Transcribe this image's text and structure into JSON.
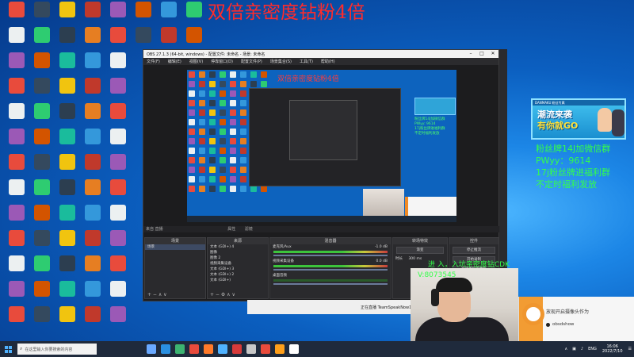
{
  "banner": {
    "text": "双倍亲密度钻粉4倍"
  },
  "obs": {
    "title": "OBS 27.1.3 (64-bit, windows) - 配置文件: 未命名 - 场景: 未命名",
    "menu": [
      "文件(F)",
      "编辑(E)",
      "视图(V)",
      "停靠窗口(D)",
      "配置文件(P)",
      "场景集合(S)",
      "工具(T)",
      "帮助(H)"
    ],
    "preview_banner": "双倍亲密度钻粉4倍",
    "preview_green_lines": [
      "粉丝牌14J加微信群",
      "PWyy: 9614",
      "17j粉丝牌进福利群",
      "不定时福利发放"
    ],
    "status_left": "来自 直播",
    "status_mid_1": "属性",
    "status_mid_2": "滤镜",
    "docks": {
      "scenes": {
        "title": "场景",
        "items": [
          "场景"
        ]
      },
      "sources": {
        "title": "来源",
        "items": [
          "文本 (GDI+) 4",
          "图像",
          "图像 2",
          "视频采集设备",
          "文本 (GDI+) 3",
          "文本 (GDI+) 2",
          "文本 (GDI+)"
        ]
      },
      "mixer": {
        "title": "混音器",
        "tracks": [
          "麦克风/Aux",
          "视频采集设备",
          "桌面音频"
        ],
        "levels": [
          "-1.0 dB",
          "0.0 dB",
          ""
        ]
      },
      "transitions": {
        "title": "转场特效",
        "type": "渐变",
        "duration_label": "时长",
        "duration": "300 ms"
      },
      "controls": {
        "title": "控件",
        "buttons": [
          "停止推流",
          "开始录制",
          "启动虚拟摄像机",
          "工作室模式",
          "设置",
          "退出"
        ]
      }
    },
    "bottom_status": "LIVE: 00:00:00   REC: 00:00:00   CPU: 2.4%   30.00 fps"
  },
  "behind_window": {
    "text": "正在直播 TeamSpeakNow1"
  },
  "overlays": {
    "card": {
      "strip": "DANMAKU 粉丝专属",
      "title_1": "潮流来袭",
      "title_2": "有你就GO"
    },
    "green_lines": [
      "粉丝牌14J加微信群",
      "PWyy：9614",
      "17j粉丝牌进福利群",
      "不定时福利发放"
    ],
    "cam_lines": [
      "进 入，入坑亲密度钻CDK",
      "V:8073545"
    ]
  },
  "notification": {
    "title": "放现开启摄像头作为",
    "item": "obsdshow"
  },
  "taskbar": {
    "search_placeholder": "在这里输入你要搜索的内容",
    "tray_lang": "ENG",
    "time": "16:06",
    "date": "2022/7/10"
  },
  "colors": {
    "banner_red": "#ff2b2b",
    "overlay_green": "#34ff4a",
    "obs_bg": "#1c1c1e",
    "desktop_blue": "#0b5fc0"
  }
}
